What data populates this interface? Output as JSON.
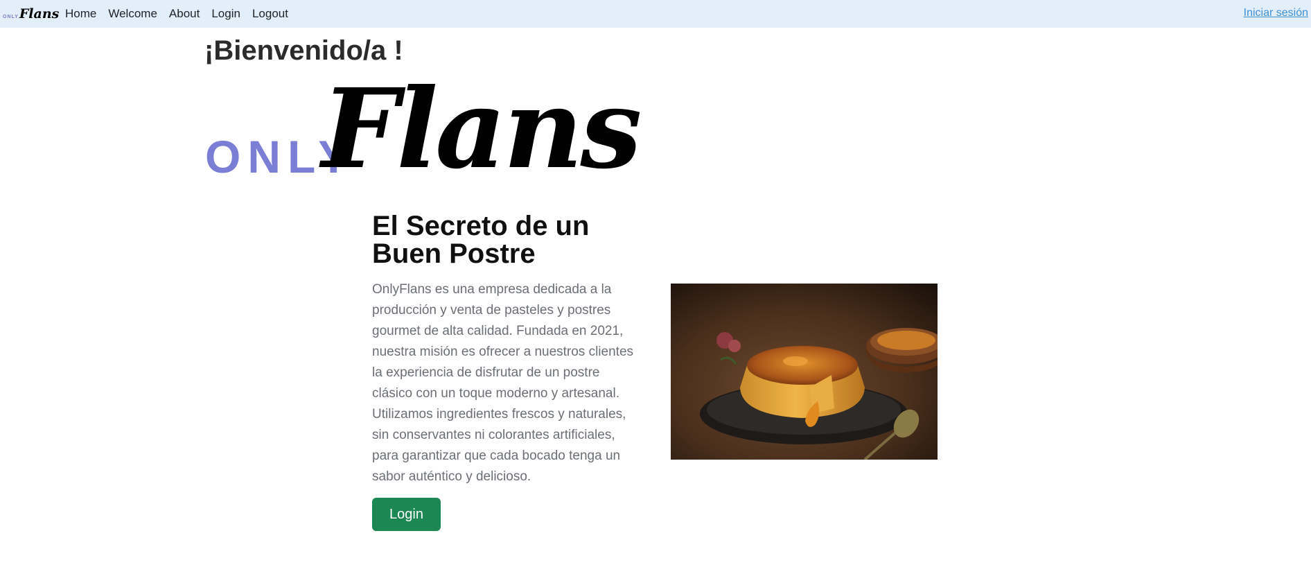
{
  "navbar": {
    "brand_only": "ONLY",
    "brand_flans": "Flans",
    "links": [
      "Home",
      "Welcome",
      "About",
      "Login",
      "Logout"
    ],
    "right_link": "Iniciar sesión"
  },
  "hero": {
    "welcome": "¡Bienvenido/a !",
    "logo_only": "ONLY",
    "logo_flans": "Flans"
  },
  "content": {
    "heading": "El Secreto de un Buen Postre",
    "paragraph": "OnlyFlans es una empresa dedicada a la producción y venta de pasteles y postres gourmet de alta calidad. Fundada en 2021, nuestra misión es ofrecer a nuestros clientes la experiencia de disfrutar de un postre clásico con un toque moderno y artesanal. Utilizamos ingredientes frescos y naturales, sin conservantes ni colorantes artificiales, para garantizar que cada bocado tenga un sabor auténtico y delicioso.",
    "button_label": "Login"
  },
  "colors": {
    "navbar_bg": "#e2eef9",
    "logo_only": "#7a7ed4",
    "button_bg": "#1d8754",
    "link": "#3d8fd6"
  }
}
